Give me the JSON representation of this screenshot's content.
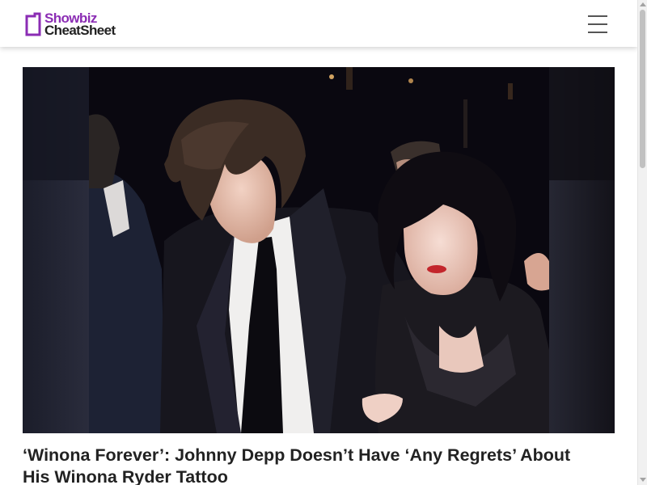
{
  "site": {
    "logo_line1": "Showbiz",
    "logo_line2": "CheatSheet",
    "logo_icon": "bookmark-frame-icon",
    "brand_color": "#8b2db4"
  },
  "header": {
    "menu_icon": "hamburger-menu-icon",
    "menu_label": "Menu"
  },
  "article": {
    "image_alt": "Johnny Depp and Winona Ryder",
    "headline": "‘Winona Forever’: Johnny Depp Doesn’t Have ‘Any Regrets’ About His Winona Ryder Tattoo"
  },
  "scrollbar": {
    "position": 0.0
  }
}
